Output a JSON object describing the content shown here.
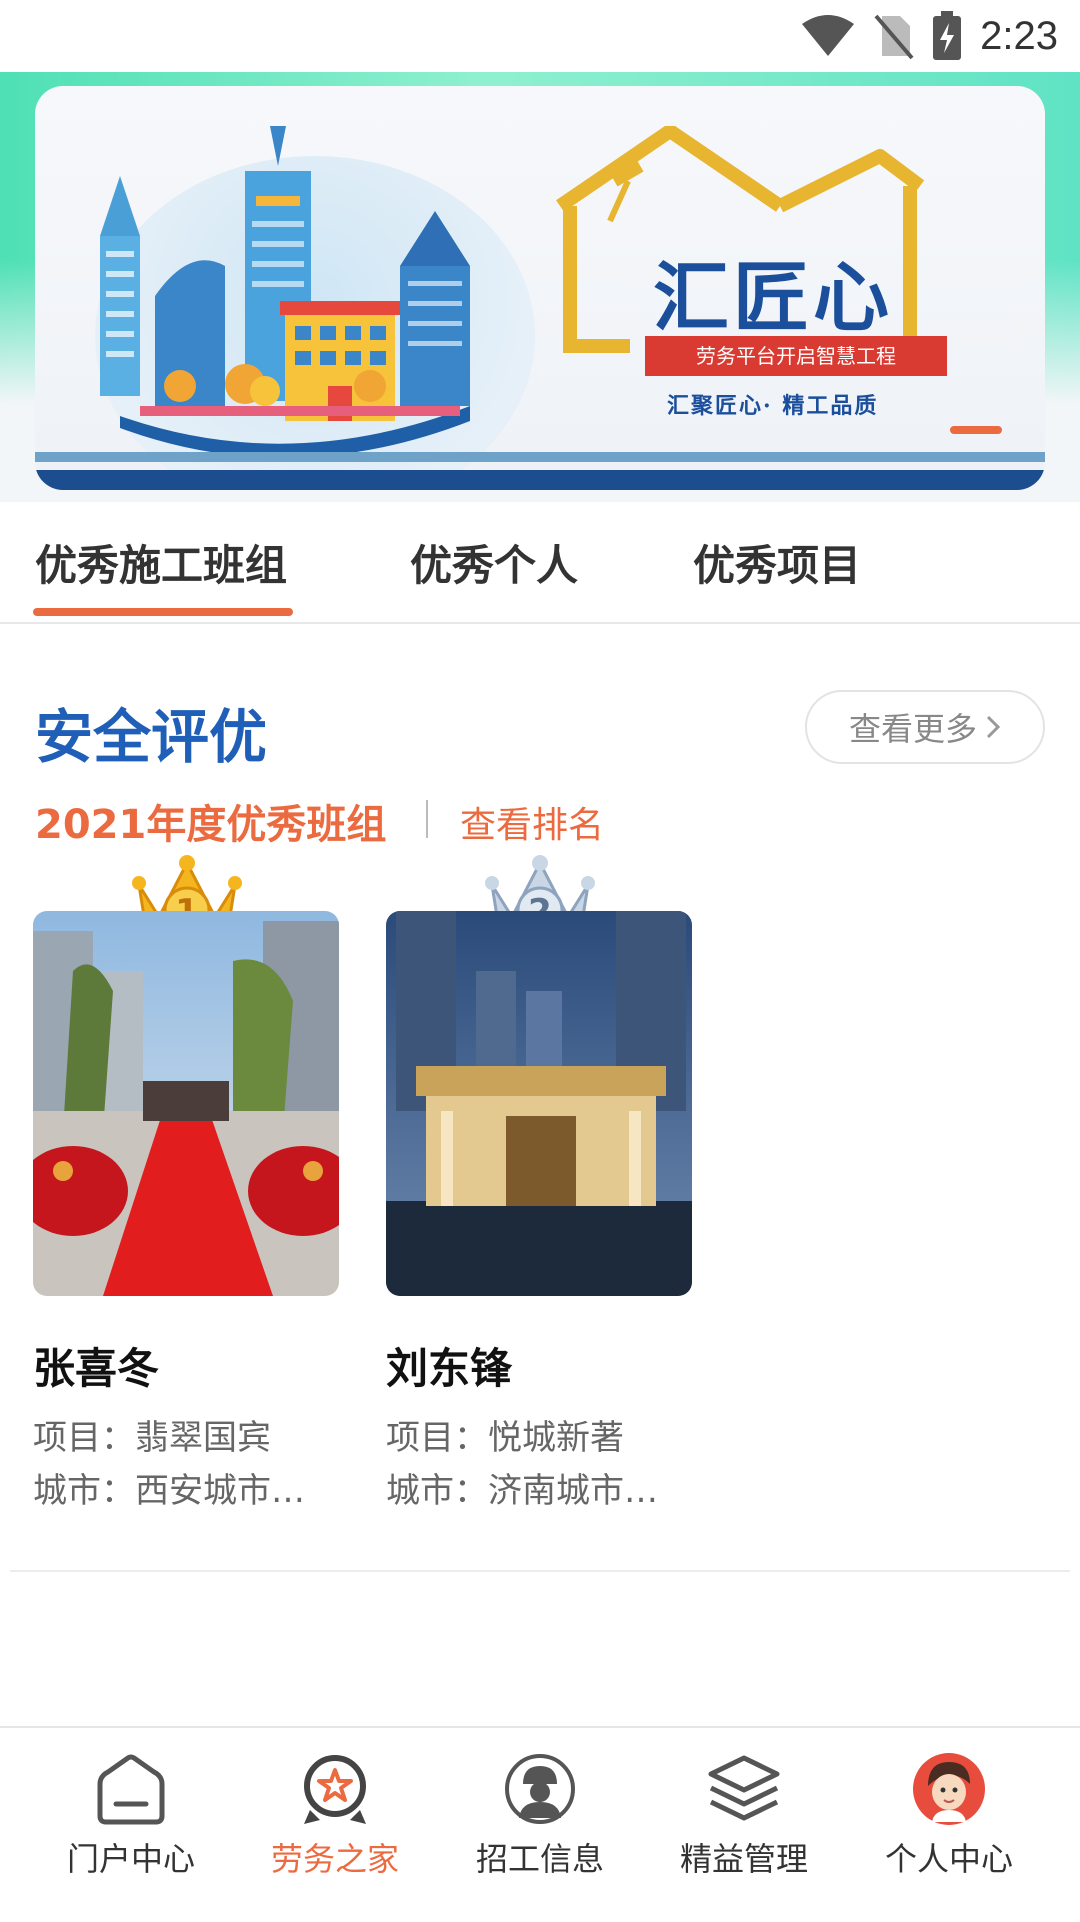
{
  "status_bar": {
    "time": "2:23"
  },
  "banner": {
    "title": "汇匠心",
    "subtitle": "劳务平台开启智慧工程",
    "slogan": "汇聚匠心· 精工品质"
  },
  "tabs": [
    {
      "label": "优秀施工班组",
      "active": true
    },
    {
      "label": "优秀个人",
      "active": false
    },
    {
      "label": "优秀项目",
      "active": false
    }
  ],
  "section": {
    "title": "安全评优",
    "more_label": "查看更多",
    "year_label": "2021年度优秀班组",
    "rank_link": "查看排名"
  },
  "cards": [
    {
      "rank": "1",
      "name": "张喜冬",
      "project": "项目：翡翠国宾",
      "city": "城市：西安城市…"
    },
    {
      "rank": "2",
      "name": "刘东锋",
      "project": "项目：悦城新著",
      "city": "城市：济南城市…"
    }
  ],
  "bottom_nav": [
    {
      "label": "门户中心",
      "icon": "home-icon",
      "active": false
    },
    {
      "label": "劳务之家",
      "icon": "award-icon",
      "active": true
    },
    {
      "label": "招工信息",
      "icon": "worker-icon",
      "active": false
    },
    {
      "label": "精益管理",
      "icon": "layers-icon",
      "active": false
    },
    {
      "label": "个人中心",
      "icon": "avatar-icon",
      "active": false
    }
  ],
  "colors": {
    "accent": "#ec6a3f",
    "brand_blue": "#1f5fb8"
  }
}
